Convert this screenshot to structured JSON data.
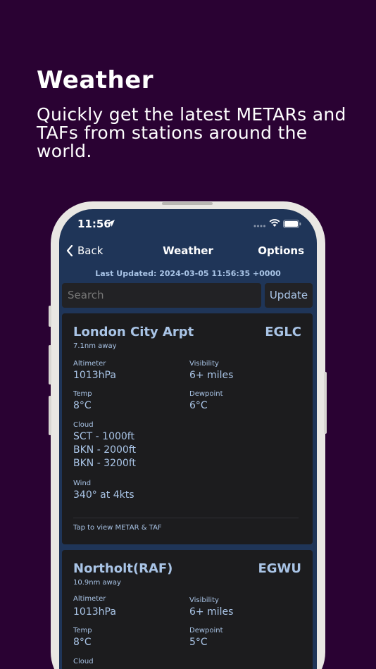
{
  "promo": {
    "headline": "Weather",
    "subline": "Quickly get the latest METARs and TAFs from stations around the world."
  },
  "status_bar": {
    "time": "11:56",
    "icons": [
      "location-arrow-icon",
      "signal-dots-icon",
      "wifi-icon",
      "battery-icon"
    ]
  },
  "nav": {
    "back_label": "Back",
    "title": "Weather",
    "options_label": "Options"
  },
  "last_updated": "Last Updated: 2024-03-05 11:56:35 +0000",
  "search": {
    "placeholder": "Search",
    "update_label": "Update"
  },
  "labels": {
    "altimeter": "Altimeter",
    "visibility": "Visibility",
    "temp": "Temp",
    "dewpoint": "Dewpoint",
    "cloud": "Cloud",
    "wind": "Wind"
  },
  "stations": [
    {
      "name": "London City Arpt",
      "code": "EGLC",
      "distance": "7.1nm away",
      "altimeter": "1013hPa",
      "visibility": "6+ miles",
      "temp": "8°C",
      "dewpoint": "6°C",
      "clouds": [
        "SCT - 1000ft",
        "BKN - 2000ft",
        "BKN - 3200ft"
      ],
      "wind": "340° at 4kts",
      "tap_hint": "Tap to view METAR & TAF"
    },
    {
      "name": "Northolt(RAF)",
      "code": "EGWU",
      "distance": "10.9nm away",
      "altimeter": "1013hPa",
      "visibility": "6+ miles",
      "temp": "8°C",
      "dewpoint": "5°C"
    }
  ],
  "colors": {
    "background": "#2a0233",
    "screen": "#1f3558",
    "card": "#1c1c1e",
    "accent": "#a9c4e6"
  }
}
